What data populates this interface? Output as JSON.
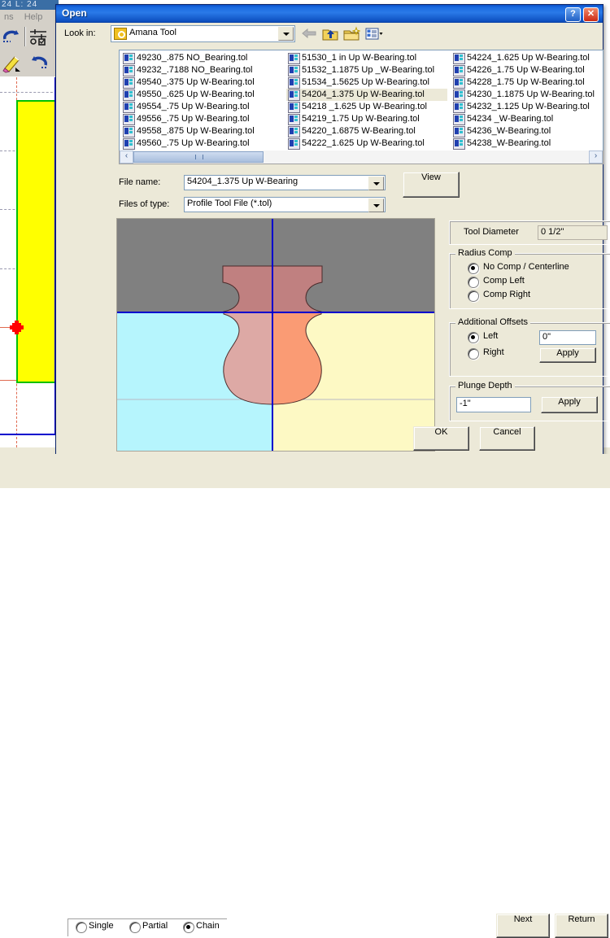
{
  "background_app": {
    "ruler_text": "24   L: 24",
    "menu_items": [
      "ns",
      "Help"
    ],
    "toolbar_icons": [
      "undo-icon",
      "settings-icon",
      "eraser-icon",
      "redo-icon"
    ]
  },
  "dialog": {
    "title": "Open",
    "titlebar_buttons": [
      {
        "name": "help-button",
        "glyph": "?"
      },
      {
        "name": "close-button",
        "glyph": "✕"
      }
    ],
    "lookin": {
      "label": "Look in:",
      "value": "Amana Tool",
      "icon": "folder-key-icon"
    },
    "nav_icons": [
      {
        "name": "back-icon",
        "glyph": "←",
        "enabled": false
      },
      {
        "name": "up-one-level-icon",
        "glyph": "↑",
        "enabled": true
      },
      {
        "name": "new-folder-icon",
        "glyph": "★",
        "enabled": true
      },
      {
        "name": "views-icon",
        "glyph": "▦",
        "enabled": true
      }
    ],
    "file_list": {
      "columns": [
        [
          "49230_.875 NO_Bearing.tol",
          "49232_.7188 NO_Bearing.tol",
          "49540_.375 Up W-Bearing.tol",
          "49550_.625 Up W-Bearing.tol",
          "49554_.75 Up W-Bearing.tol",
          "49556_.75 Up W-Bearing.tol",
          "49558_.875 Up W-Bearing.tol",
          "49560_.75 Up W-Bearing.tol"
        ],
        [
          "51530_1 in Up W-Bearing.tol",
          "51532_1.1875 Up _W-Bearing.tol",
          "51534_1.5625 Up W-Bearing.tol",
          "54204_1.375 Up  W-Bearing.tol",
          "54218 _1.625 Up W-Bearing.tol",
          "54219_1.75 Up W-Bearing.tol",
          "54220_1.6875 W-Bearing.tol",
          "54222_1.625 Up W-Bearing.tol"
        ],
        [
          "54224_1.625 Up W-Bearing.tol",
          "54226_1.75 Up W-Bearing.tol",
          "54228_1.75 Up W-Bearing.tol",
          "54230_1.1875 Up W-Bearing.tol",
          "54232_1.125 Up W-Bearing.tol",
          "54234 _W-Bearing.tol",
          "54236_W-Bearing.tol",
          "54238_W-Bearing.tol"
        ]
      ],
      "selected_column": 1,
      "selected_index": 3
    },
    "scrollbar": {
      "left_glyph": "‹",
      "right_glyph": "›"
    },
    "filename": {
      "label": "File name:",
      "value": "54204_1.375 Up  W-Bearing"
    },
    "filetype": {
      "label": "Files of type:",
      "value": "Profile Tool File (*.tol)"
    },
    "view_button": "View",
    "tool_diameter": {
      "label": "Tool Diameter",
      "value": "0 1/2\""
    },
    "radius_comp": {
      "title": "Radius Comp",
      "options": [
        "No Comp / Centerline",
        "Comp Left",
        "Comp Right"
      ],
      "selected": 0
    },
    "additional_offsets": {
      "title": "Additional Offsets",
      "options": [
        "Left",
        "Right"
      ],
      "selected": 0,
      "value": "0\"",
      "apply_label": "Apply"
    },
    "plunge_depth": {
      "title": "Plunge Depth",
      "value": "-1\"",
      "apply_label": "Apply"
    },
    "ok_label": "OK",
    "cancel_label": "Cancel",
    "preview": {
      "name": "tool-profile-preview",
      "colors": {
        "upper": "#808080",
        "lower_left": "#b6f5fd",
        "lower_right": "#fdf9c4",
        "profile_upper": "#c08080",
        "profile_lower_left": "#dda9a5",
        "profile_lower_right": "#fa9b74",
        "crosshair": "#0000cd"
      }
    }
  },
  "bottom_bar": {
    "modes": [
      "Single",
      "Partial",
      "Chain"
    ],
    "selected_mode": 2,
    "next_label": "Next",
    "return_label": "Return"
  },
  "theme": {
    "face": "#ece9d8",
    "title_blue": "#0a50c8",
    "highlight": "#ece9d8"
  }
}
